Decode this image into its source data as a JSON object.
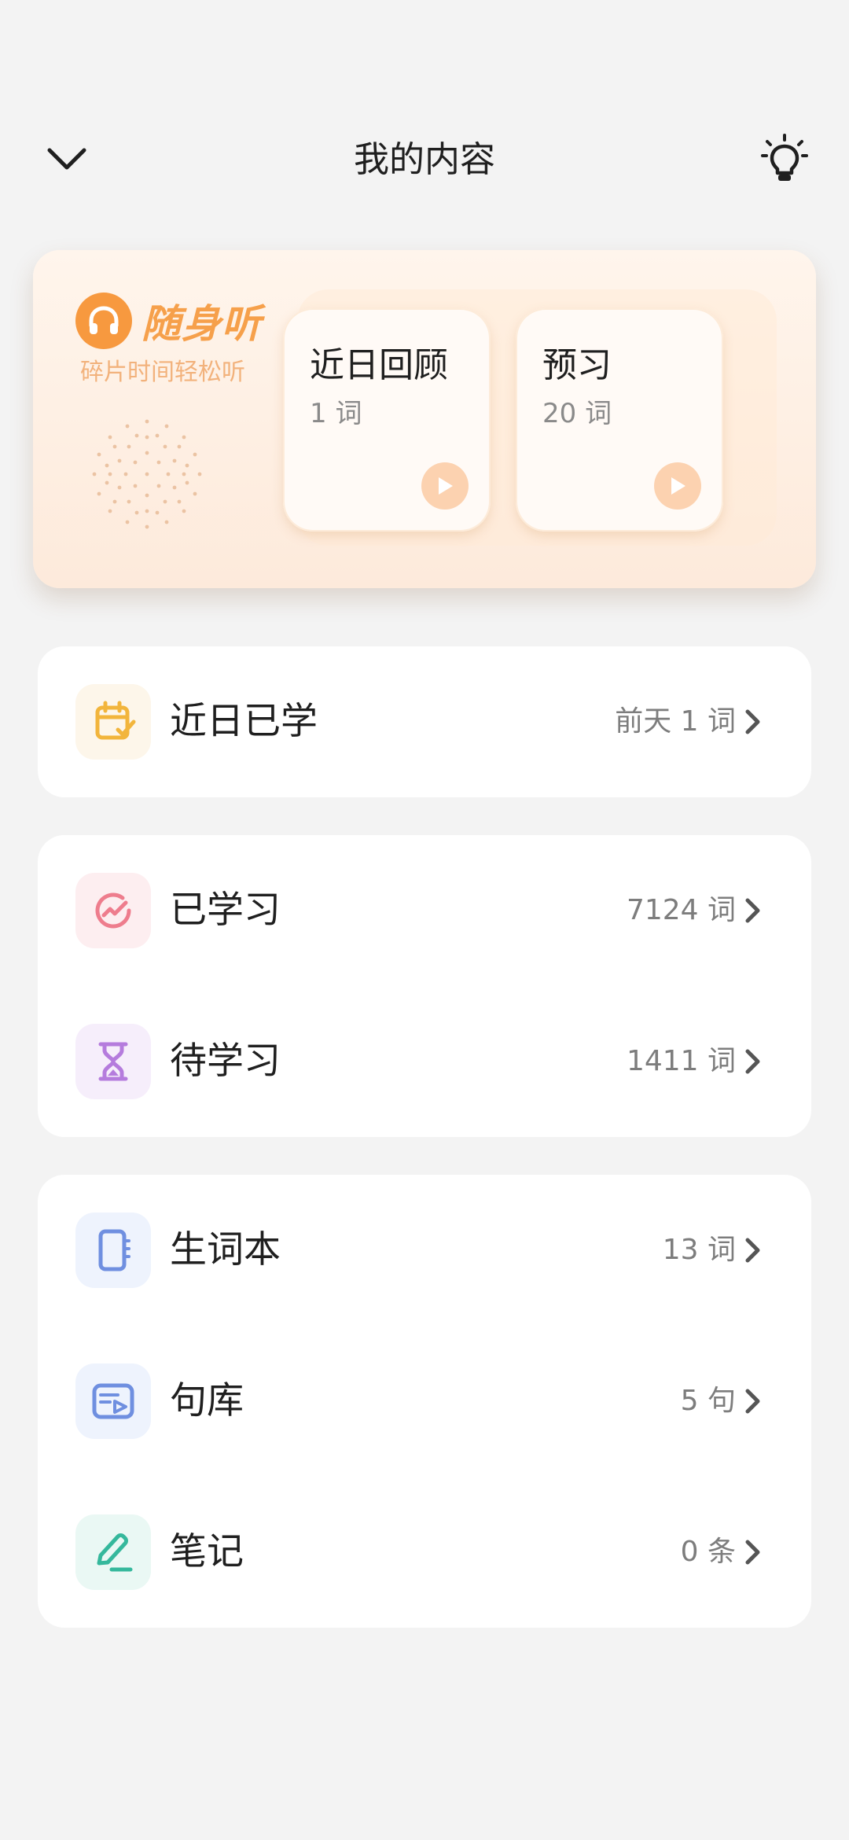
{
  "header": {
    "title": "我的内容"
  },
  "hero": {
    "brand": "随身听",
    "subtitle": "碎片时间轻松听",
    "cards": [
      {
        "title": "近日回顾",
        "count": "1 词"
      },
      {
        "title": "预习",
        "count": "20 词"
      }
    ]
  },
  "rows": {
    "recent": {
      "label": "近日已学",
      "value": "前天 1 词"
    },
    "learned": {
      "label": "已学习",
      "value": "7124 词"
    },
    "pending": {
      "label": "待学习",
      "value": "1411 词"
    },
    "vocab": {
      "label": "生词本",
      "value": "13 词"
    },
    "sentences": {
      "label": "句库",
      "value": "5 句"
    },
    "notes": {
      "label": "笔记",
      "value": "0 条"
    }
  },
  "colors": {
    "accent_orange": "#f7993f",
    "calendar_icon": "#f2b53c",
    "learned_icon": "#ee7d8d",
    "pending_icon": "#b57cdd",
    "vocab_icon": "#6f8fe0",
    "notes_icon": "#35b89c"
  }
}
